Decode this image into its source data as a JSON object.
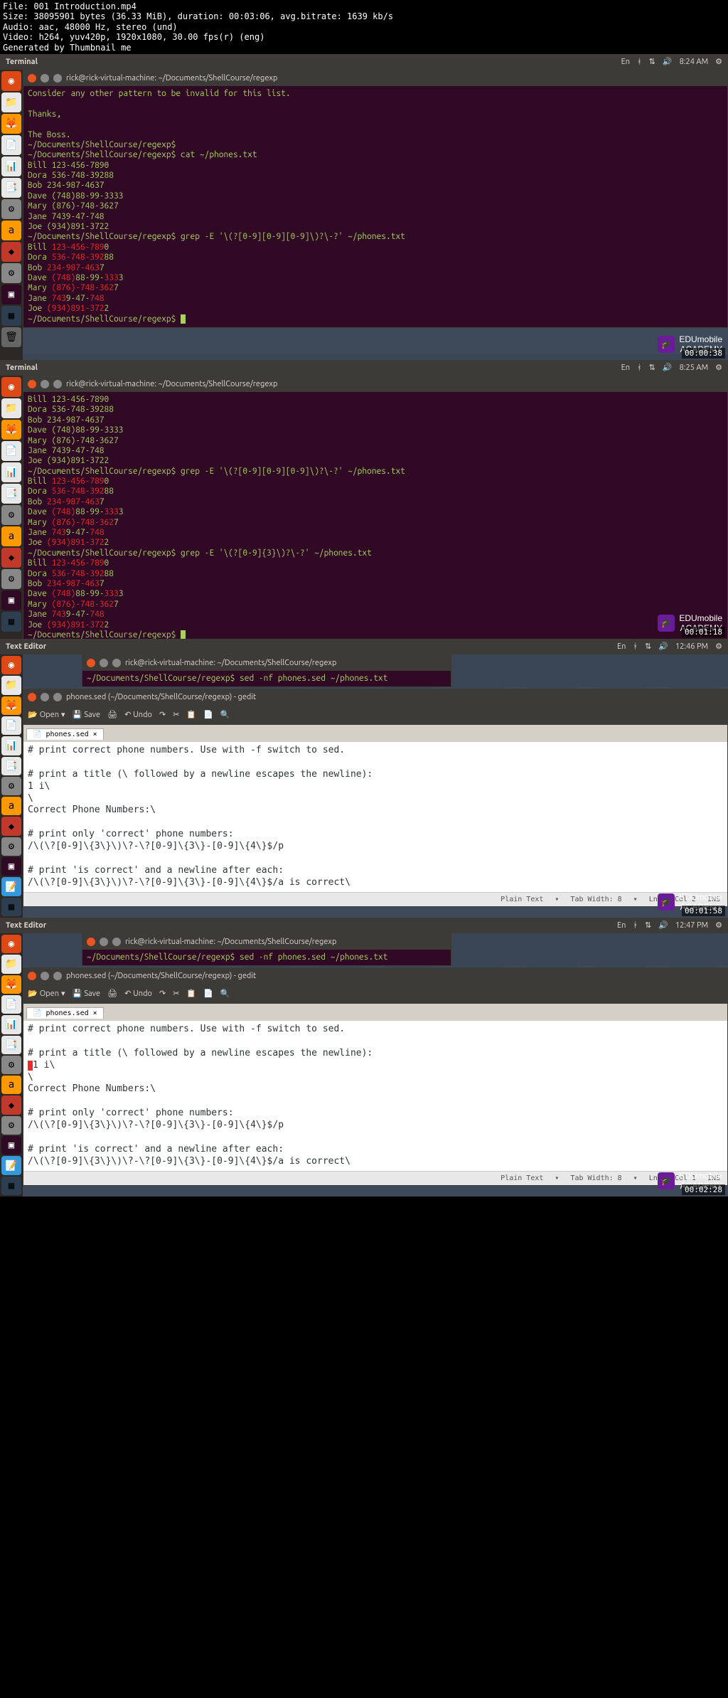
{
  "file_info": {
    "filename": "File: 001 Introduction.mp4",
    "size": "Size: 38095901 bytes (36.33 MiB), duration: 00:03:06, avg.bitrate: 1639 kb/s",
    "audio": "Audio: aac, 48000 Hz, stereo (und)",
    "video": "Video: h264, yuv420p, 1920x1080, 30.00 fps(r) (eng)",
    "generated": "Generated by Thumbnail me"
  },
  "frame1": {
    "menubar_title": "Terminal",
    "time": "8:24 AM",
    "timestamp": "00:00:38",
    "window_title": "rick@rick-virtual-machine: ~/Documents/ShellCourse/regexp",
    "lines": [
      {
        "type": "green",
        "text": "Consider any other pattern to be invalid for this list."
      },
      {
        "type": "blank",
        "text": ""
      },
      {
        "type": "green",
        "text": "Thanks,"
      },
      {
        "type": "blank",
        "text": ""
      },
      {
        "type": "green",
        "text": "The Boss."
      },
      {
        "type": "green",
        "text": "~/Documents/ShellCourse/regexp$"
      },
      {
        "type": "green",
        "text": "~/Documents/ShellCourse/regexp$ cat ~/phones.txt"
      },
      {
        "type": "green",
        "text": "Bill    123-456-7890"
      },
      {
        "type": "green",
        "text": "Dora    536-748-39288"
      },
      {
        "type": "green",
        "text": "Bob     234-987-4637"
      },
      {
        "type": "green",
        "text": "Dave    (748)88-99-3333"
      },
      {
        "type": "green",
        "text": "Mary    (876)-748-3627"
      },
      {
        "type": "green",
        "text": "Jane    7439-47-748"
      },
      {
        "type": "green",
        "text": "Joe     (934)891-3722"
      },
      {
        "type": "green",
        "text": "~/Documents/ShellCourse/regexp$ grep -E '\\(?[0-9][0-9][0-9]\\)?\\-?' ~/phones.txt"
      },
      {
        "type": "mix",
        "parts": [
          {
            "c": "green",
            "t": "Bill    "
          },
          {
            "c": "red",
            "t": "123-456-789"
          },
          {
            "c": "green",
            "t": "0"
          }
        ]
      },
      {
        "type": "mix",
        "parts": [
          {
            "c": "green",
            "t": "Dora    "
          },
          {
            "c": "red",
            "t": "536-748-392"
          },
          {
            "c": "green",
            "t": "88"
          }
        ]
      },
      {
        "type": "mix",
        "parts": [
          {
            "c": "green",
            "t": "Bob     "
          },
          {
            "c": "red",
            "t": "234-987-463"
          },
          {
            "c": "green",
            "t": "7"
          }
        ]
      },
      {
        "type": "mix",
        "parts": [
          {
            "c": "green",
            "t": "Dave    "
          },
          {
            "c": "red",
            "t": "(748)"
          },
          {
            "c": "green",
            "t": "88-99-"
          },
          {
            "c": "red",
            "t": "333"
          },
          {
            "c": "green",
            "t": "3"
          }
        ]
      },
      {
        "type": "mix",
        "parts": [
          {
            "c": "green",
            "t": "Mary    "
          },
          {
            "c": "red",
            "t": "(876)-748-362"
          },
          {
            "c": "green",
            "t": "7"
          }
        ]
      },
      {
        "type": "mix",
        "parts": [
          {
            "c": "green",
            "t": "Jane    "
          },
          {
            "c": "red",
            "t": "743"
          },
          {
            "c": "green",
            "t": "9-47-"
          },
          {
            "c": "red",
            "t": "748"
          }
        ]
      },
      {
        "type": "mix",
        "parts": [
          {
            "c": "green",
            "t": "Joe     "
          },
          {
            "c": "red",
            "t": "(934)891-372"
          },
          {
            "c": "green",
            "t": "2"
          }
        ]
      },
      {
        "type": "prompt",
        "text": "~/Documents/ShellCourse/regexp$ "
      }
    ]
  },
  "frame2": {
    "menubar_title": "Terminal",
    "time": "8:25 AM",
    "timestamp": "00:01:18",
    "window_title": "rick@rick-virtual-machine: ~/Documents/ShellCourse/regexp",
    "lines": [
      {
        "type": "green",
        "text": "Bill    123-456-7890"
      },
      {
        "type": "green",
        "text": "Dora    536-748-39288"
      },
      {
        "type": "green",
        "text": "Bob     234-987-4637"
      },
      {
        "type": "green",
        "text": "Dave    (748)88-99-3333"
      },
      {
        "type": "green",
        "text": "Mary    (876)-748-3627"
      },
      {
        "type": "green",
        "text": "Jane    7439-47-748"
      },
      {
        "type": "green",
        "text": "Joe     (934)891-3722"
      },
      {
        "type": "green",
        "text": "~/Documents/ShellCourse/regexp$ grep -E '\\(?[0-9][0-9][0-9]\\)?\\-?' ~/phones.txt"
      },
      {
        "type": "mix",
        "parts": [
          {
            "c": "green",
            "t": "Bill    "
          },
          {
            "c": "red",
            "t": "123-456-789"
          },
          {
            "c": "green",
            "t": "0"
          }
        ]
      },
      {
        "type": "mix",
        "parts": [
          {
            "c": "green",
            "t": "Dora    "
          },
          {
            "c": "red",
            "t": "536-748-392"
          },
          {
            "c": "green",
            "t": "88"
          }
        ]
      },
      {
        "type": "mix",
        "parts": [
          {
            "c": "green",
            "t": "Bob     "
          },
          {
            "c": "red",
            "t": "234-987-463"
          },
          {
            "c": "green",
            "t": "7"
          }
        ]
      },
      {
        "type": "mix",
        "parts": [
          {
            "c": "green",
            "t": "Dave    "
          },
          {
            "c": "red",
            "t": "(748)"
          },
          {
            "c": "green",
            "t": "88-99-"
          },
          {
            "c": "red",
            "t": "333"
          },
          {
            "c": "green",
            "t": "3"
          }
        ]
      },
      {
        "type": "mix",
        "parts": [
          {
            "c": "green",
            "t": "Mary    "
          },
          {
            "c": "red",
            "t": "(876)-748-362"
          },
          {
            "c": "green",
            "t": "7"
          }
        ]
      },
      {
        "type": "mix",
        "parts": [
          {
            "c": "green",
            "t": "Jane    "
          },
          {
            "c": "red",
            "t": "743"
          },
          {
            "c": "green",
            "t": "9-47-"
          },
          {
            "c": "red",
            "t": "748"
          }
        ]
      },
      {
        "type": "mix",
        "parts": [
          {
            "c": "green",
            "t": "Joe     "
          },
          {
            "c": "red",
            "t": "(934)891-372"
          },
          {
            "c": "green",
            "t": "2"
          }
        ]
      },
      {
        "type": "green",
        "text": "~/Documents/ShellCourse/regexp$ grep -E '\\(?[0-9]{3}\\)?\\-?' ~/phones.txt"
      },
      {
        "type": "mix",
        "parts": [
          {
            "c": "green",
            "t": "Bill    "
          },
          {
            "c": "red",
            "t": "123-456-789"
          },
          {
            "c": "green",
            "t": "0"
          }
        ]
      },
      {
        "type": "mix",
        "parts": [
          {
            "c": "green",
            "t": "Dora    "
          },
          {
            "c": "red",
            "t": "536-748-392"
          },
          {
            "c": "green",
            "t": "88"
          }
        ]
      },
      {
        "type": "mix",
        "parts": [
          {
            "c": "green",
            "t": "Bob     "
          },
          {
            "c": "red",
            "t": "234-987-463"
          },
          {
            "c": "green",
            "t": "7"
          }
        ]
      },
      {
        "type": "mix",
        "parts": [
          {
            "c": "green",
            "t": "Dave    "
          },
          {
            "c": "red",
            "t": "(748)"
          },
          {
            "c": "green",
            "t": "88-99-"
          },
          {
            "c": "red",
            "t": "333"
          },
          {
            "c": "green",
            "t": "3"
          }
        ]
      },
      {
        "type": "mix",
        "parts": [
          {
            "c": "green",
            "t": "Mary    "
          },
          {
            "c": "red",
            "t": "(876)-748-362"
          },
          {
            "c": "green",
            "t": "7"
          }
        ]
      },
      {
        "type": "mix",
        "parts": [
          {
            "c": "green",
            "t": "Jane    "
          },
          {
            "c": "red",
            "t": "743"
          },
          {
            "c": "green",
            "t": "9-47-"
          },
          {
            "c": "red",
            "t": "748"
          }
        ]
      },
      {
        "type": "mix",
        "parts": [
          {
            "c": "green",
            "t": "Joe     "
          },
          {
            "c": "red",
            "t": "(934)891-372"
          },
          {
            "c": "green",
            "t": "2"
          }
        ]
      },
      {
        "type": "prompt",
        "text": "~/Documents/ShellCourse/regexp$ "
      }
    ]
  },
  "frame3": {
    "menubar_title": "Text Editor",
    "time": "12:46 PM",
    "timestamp": "00:01:58",
    "mini_term_title": "rick@rick-virtual-machine: ~/Documents/ShellCourse/regexp",
    "mini_term_line": "~/Documents/ShellCourse/regexp$ sed -nf phones.sed ~/phones.txt",
    "gedit_title": "phones.sed (~/Documents/ShellCourse/regexp) - gedit",
    "toolbar": {
      "open": "Open",
      "save": "Save",
      "undo": "Undo"
    },
    "tab_name": "phones.sed",
    "content": "# print correct phone numbers. Use with -f switch to sed.\n\n# print a title (\\ followed by a newline escapes the newline):\n1 i\\\n\\\nCorrect Phone Numbers:\\\n\n# print only 'correct' phone numbers:\n/\\(\\?[0-9]\\{3\\}\\)\\?-\\?[0-9]\\{3\\}-[0-9]\\{4\\}$/p\n\n# print 'is correct' and a newline after each:\n/\\(\\?[0-9]\\{3\\}\\)\\?-\\?[0-9]\\{3\\}-[0-9]\\{4\\}$/a is correct\\\n",
    "status": {
      "syntax": "Plain Text",
      "tabwidth": "Tab Width: 8",
      "pos": "Ln 5, Col 2",
      "mode": "INS"
    }
  },
  "frame4": {
    "menubar_title": "Text Editor",
    "time": "12:47 PM",
    "timestamp": "00:02:28",
    "mini_term_title": "rick@rick-virtual-machine: ~/Documents/ShellCourse/regexp",
    "mini_term_line": "~/Documents/ShellCourse/regexp$ sed -nf phones.sed ~/phones.txt",
    "gedit_title": "phones.sed (~/Documents/ShellCourse/regexp) - gedit",
    "toolbar": {
      "open": "Open",
      "save": "Save",
      "undo": "Undo"
    },
    "tab_name": "phones.sed",
    "content_pre": "# print correct phone numbers. Use with -f switch to sed.\n\n# print a title (\\ followed by a newline escapes the newline):\n",
    "content_cursor_line": "1",
    "content_post": " i\\\n\\\nCorrect Phone Numbers:\\\n\n# print only 'correct' phone numbers:\n/\\(\\?[0-9]\\{3\\}\\)\\?-\\?[0-9]\\{3\\}-[0-9]\\{4\\}$/p\n\n# print 'is correct' and a newline after each:\n/\\(\\?[0-9]\\{3\\}\\)\\?-\\?[0-9]\\{3\\}-[0-9]\\{4\\}$/a is correct\\\n",
    "status": {
      "syntax": "Plain Text",
      "tabwidth": "Tab Width: 8",
      "pos": "Ln 4, Col 1",
      "mode": "INS"
    }
  },
  "watermark": {
    "brand1": "EDUmobile",
    "brand2": "ACADEMY"
  },
  "indicator": "En"
}
